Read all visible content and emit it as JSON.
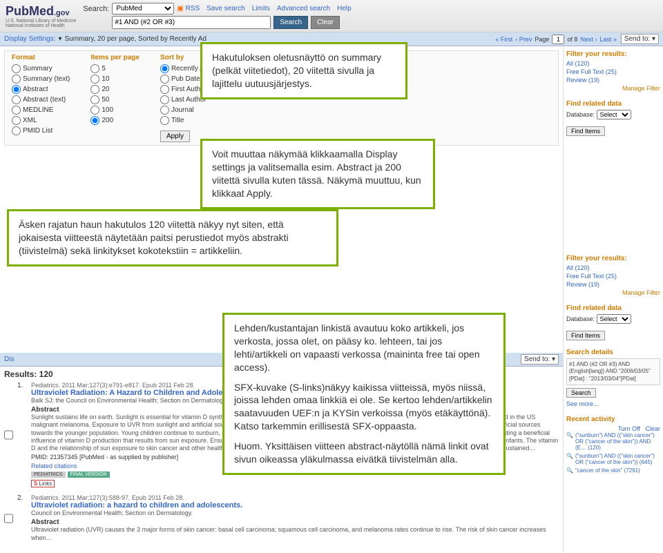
{
  "header": {
    "logo_main": "PubMed",
    "logo_gov": ".gov",
    "logo_sub1": "U.S. National Library of Medicine",
    "logo_sub2": "National Institutes of Health",
    "search_label": "Search:",
    "search_db": "PubMed",
    "search_query": "#1 AND (#2 OR #3)",
    "search_btn": "Search",
    "clear_btn": "Clear",
    "links": {
      "rss": "RSS",
      "save": "Save search",
      "limits": "Limits",
      "advanced": "Advanced search",
      "help": "Help"
    }
  },
  "toolbar1": {
    "label": "Display Settings:",
    "summary": "Summary, 20 per page, Sorted by Recently Ad",
    "send_to": "Send to:",
    "page_label": "Page",
    "page_val": "1",
    "page_of": "of 8",
    "first": "« First",
    "prev": "‹ Prev",
    "next": "Next ›",
    "last": "Last »"
  },
  "display": {
    "cols": {
      "format": {
        "title": "Format",
        "opts": [
          "Summary",
          "Summary (text)",
          "Abstract",
          "Abstract (text)",
          "MEDLINE",
          "XML",
          "PMID List"
        ],
        "selected": "Abstract"
      },
      "items": {
        "title": "Items per page",
        "opts": [
          "5",
          "10",
          "20",
          "50",
          "100",
          "200"
        ],
        "selected": "200"
      },
      "sort": {
        "title": "Sort by",
        "opts": [
          "Recently Added",
          "Pub Date",
          "First Author",
          "Last Author",
          "Journal",
          "Title"
        ],
        "selected": "Recently Added"
      }
    },
    "apply": "Apply"
  },
  "callouts": {
    "c1": "Hakutuloksen oletusnäyttö on summary (pelkät viitetiedot), 20 viitettä sivulla ja lajittelu uutuusjärjestys.",
    "c2": "Voit muuttaa näkymää klikkaamalla Display settings ja valitsemalla esim. Abstract ja 200 viitettä sivulla kuten tässä. Näkymä muuttuu, kun klikkaat Apply.",
    "c3": "Äsken rajatun haun hakutulos 120 viitettä näkyy nyt siten, että jokaisesta viitteestä näytetään paitsi perustiedot myös abstrakti (tiivistelmä) sekä linkitykset kokotekstiin = artikkeliin.",
    "c4a": "Lehden/kustantajan linkistä avautuu koko artikkeli, jos verkosta, jossa olet, on pääsy ko. lehteen, tai jos lehti/artikkeli on vapaasti verkossa (maininta free tai open access).",
    "c4b": "SFX-kuvake (S-links)näkyy kaikissa viitteissä, myös niissä, joissa lehden omaa linkkiä ei ole. Se kertoo lehden/artikkelin saatavuuden UEF:n ja KYSin verkoissa (myös etäkäyttönä). Katso tarkemmin erillisestä SFX-oppaasta.",
    "c4c": "Huom. Yksittäisen viitteen abstract-näytöllä nämä linkit ovat sivun oikeassa yläkulmassa eivätkä tiivistelmän alla."
  },
  "sidebar": {
    "filter_title": "Filter your results:",
    "filters": [
      "All (120)",
      "Free Full Text (25)",
      "Review (19)"
    ],
    "manage": "Manage Filter",
    "related_title": "Find related data",
    "db_label": "Database:",
    "db_select": "Select",
    "find_btn": "Find Items",
    "details_title": "Search details",
    "details_text": "#1 AND (#2 OR #3) AND (English[lang])\nAND \"2006/03/05\"[PDat] : \"2013/03/04\"[PDat]",
    "search_btn": "Search",
    "see_more": "See more...",
    "recent_title": "Recent activity",
    "turn_off": "Turn Off",
    "clear": "Clear",
    "recent": [
      "(\"sunburn\") AND ((\"skin cancer\") OR (\"cancer of the skin\")) AND (E… (120)",
      "(\"sunburn\") AND ((\"skin cancer\") OR (\"cancer of the skin\")) (645)",
      "\"cancer of the skin\" (7291)"
    ]
  },
  "toolbar2": {
    "label": "Dis",
    "send_to": "Send to:"
  },
  "results": {
    "count": "Results: 120",
    "items": [
      {
        "num": "1.",
        "journal": "Pediatrics. 2011 Mar;127(3):e791-e817. Epub 2011 Feb 28.",
        "title": "Ultraviolet Radiation: A Hazard to Children and Adolescents.",
        "authors": "Balk SJ; the Council on Environmental Health; Section on Dermatology.",
        "abs_label": "Abstract",
        "abs": "Sunlight sustains life on earth. Sunlight is essential for vitamin D synthesis in the skin. The sun is a major public health problem; more than 2 million new cases are diagnosed in the US malignant melanoma. Exposure to UVR from sunlight and artificial sources early in life and people overexpose themselves to sun and intentionally expose themselves to artificial sources towards the younger population. Young children continue to sunburn, and teenagers and adults and children and adults. In addition, there is accumulating information suggesting a beneficial influence of vitamin D production that results from sun exposure. Ensuring vitamin D adequacy while intake of 400 IU of vitamin D will prevent vitamin D deficiency rickets in infants. The vitamin D and the relationship of sun exposure to skin cancer and other health effects, the relation pediatrician's role in preventing skin cancer. In addition to pediatricians' efforts, a sustained…",
        "pmid": "PMID: 21357345 [PubMed - as supplied by publisher]",
        "related": "Related citations",
        "tag1": "PEDIATRICS",
        "tag2": "FINAL VERSION",
        "slinks": "Links"
      },
      {
        "num": "2.",
        "journal": "Pediatrics. 2011 Mar;127(3):588-97. Epub 2011 Feb 28.",
        "title": "Ultraviolet radiation: a hazard to children and adolescents.",
        "authors": "Council on Environmental Health; Section on Dermatology.",
        "abs_label": "Abstract",
        "abs": "Ultraviolet radiation (UVR) causes the 3 major forms of skin cancer: basal cell carcinoma; squamous cell carcinoma, and melanoma rates continue to rise. The risk of skin cancer increases when…"
      }
    ]
  }
}
